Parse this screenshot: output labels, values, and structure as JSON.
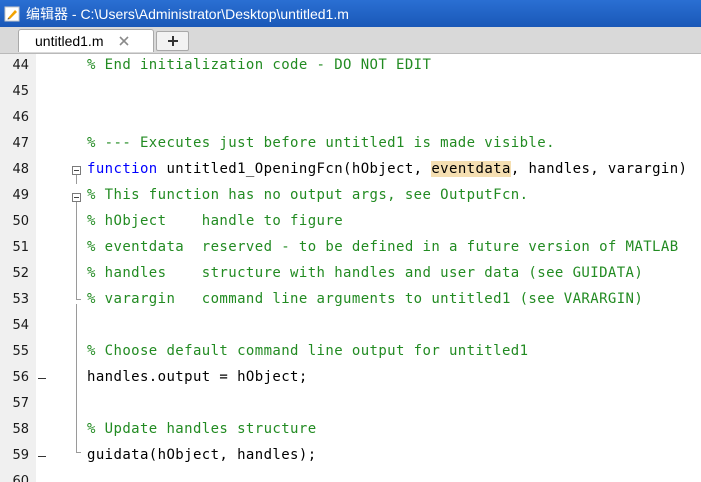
{
  "window": {
    "title": "编辑器 - C:\\Users\\Administrator\\Desktop\\untitled1.m"
  },
  "tabs": {
    "active_label": "untitled1.m",
    "add_label": "+"
  },
  "colors": {
    "comment": "#228B22",
    "keyword": "#0000ff",
    "highlight": "#f5dfb2",
    "titlebar": "#1a58b8"
  },
  "lines": [
    {
      "num": "44",
      "segments": [
        {
          "t": "% End initialization code - DO NOT EDIT",
          "c": "comment"
        }
      ]
    },
    {
      "num": "45",
      "segments": []
    },
    {
      "num": "46",
      "segments": []
    },
    {
      "num": "47",
      "segments": [
        {
          "t": "% --- Executes just before untitled1 is made visible.",
          "c": "comment"
        }
      ]
    },
    {
      "num": "48",
      "segments": [
        {
          "t": "function",
          "c": "keyword"
        },
        {
          "t": " untitled1_OpeningFcn(hObject, ",
          "c": "plain"
        },
        {
          "t": "eventdata",
          "c": "hl"
        },
        {
          "t": ", handles, varargin)",
          "c": "plain"
        }
      ]
    },
    {
      "num": "49",
      "segments": [
        {
          "t": "% This function has no output args, see OutputFcn.",
          "c": "comment"
        }
      ]
    },
    {
      "num": "50",
      "segments": [
        {
          "t": "% hObject    handle to figure",
          "c": "comment"
        }
      ]
    },
    {
      "num": "51",
      "segments": [
        {
          "t": "% eventdata  reserved - to be defined in a future version of MATLAB",
          "c": "comment"
        }
      ]
    },
    {
      "num": "52",
      "segments": [
        {
          "t": "% handles    structure with handles and user data (see GUIDATA)",
          "c": "comment"
        }
      ]
    },
    {
      "num": "53",
      "segments": [
        {
          "t": "% varargin   command line arguments to untitled1 (see VARARGIN)",
          "c": "comment"
        }
      ]
    },
    {
      "num": "54",
      "segments": []
    },
    {
      "num": "55",
      "segments": [
        {
          "t": "% Choose default command line output for untitled1",
          "c": "comment"
        }
      ]
    },
    {
      "num": "56",
      "segments": [
        {
          "t": "handles.output = hObject;",
          "c": "plain"
        }
      ],
      "breakpoint_dash": true
    },
    {
      "num": "57",
      "segments": []
    },
    {
      "num": "58",
      "segments": [
        {
          "t": "% Update handles structure",
          "c": "comment"
        }
      ]
    },
    {
      "num": "59",
      "segments": [
        {
          "t": "guidata(hObject, handles);",
          "c": "plain"
        }
      ],
      "breakpoint_dash": true
    },
    {
      "num": "60",
      "segments": []
    }
  ]
}
